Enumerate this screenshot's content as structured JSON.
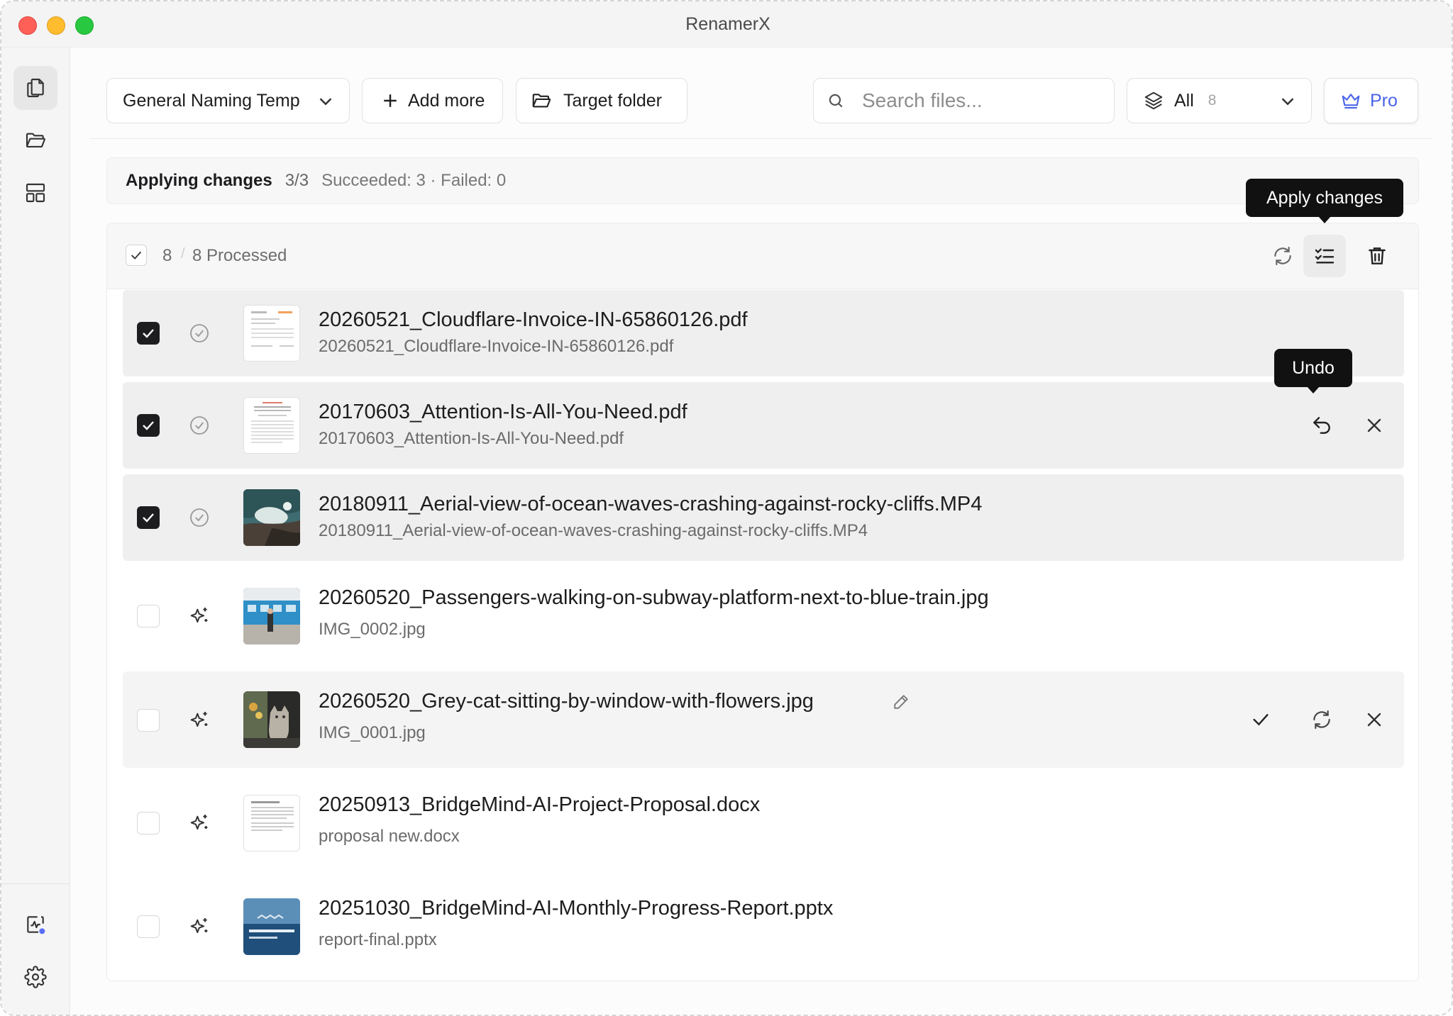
{
  "window": {
    "title": "RenamerX"
  },
  "sidebar": {
    "top": [
      "files-icon",
      "folder-open-icon",
      "layout-icon"
    ],
    "bottom": [
      "activity-icon",
      "gear-icon"
    ]
  },
  "toolbar": {
    "template_label": "General Naming Temp",
    "add_more_label": "Add more",
    "target_folder_label": "Target folder",
    "search_placeholder": "Search files...",
    "filter_label": "All",
    "filter_count": "8",
    "pro_label": "Pro"
  },
  "status": {
    "label": "Applying changes",
    "progress": "3/3",
    "result": "Succeeded: 3 · Failed: 0"
  },
  "list_header": {
    "selected_count": "8",
    "separator": "/",
    "processed_label": "8 Processed",
    "tooltip_apply": "Apply changes"
  },
  "files": [
    {
      "new_name": "20260521_Cloudflare-Invoice-IN-65860126.pdf",
      "original_name": "20260521_Cloudflare-Invoice-IN-65860126.pdf",
      "checked": true,
      "state": "done"
    },
    {
      "new_name": "20170603_Attention-Is-All-You-Need.pdf",
      "original_name": "20170603_Attention-Is-All-You-Need.pdf",
      "checked": true,
      "state": "done",
      "tooltip": "Undo"
    },
    {
      "new_name": "20180911_Aerial-view-of-ocean-waves-crashing-against-rocky-cliffs.MP4",
      "original_name": "20180911_Aerial-view-of-ocean-waves-crashing-against-rocky-cliffs.MP4",
      "checked": true,
      "state": "done"
    },
    {
      "new_name": "20260520_Passengers-walking-on-subway-platform-next-to-blue-train.jpg",
      "original_name": "IMG_0002.jpg",
      "checked": false,
      "state": "suggested"
    },
    {
      "new_name": "20260520_Grey-cat-sitting-by-window-with-flowers.jpg",
      "original_name": "IMG_0001.jpg",
      "checked": false,
      "state": "suggested"
    },
    {
      "new_name": "20250913_BridgeMind-AI-Project-Proposal.docx",
      "original_name": "proposal new.docx",
      "checked": false,
      "state": "suggested"
    },
    {
      "new_name": "20251030_BridgeMind-AI-Monthly-Progress-Report.pptx",
      "original_name": "report-final.pptx",
      "checked": false,
      "state": "suggested"
    }
  ],
  "colors": {
    "accent_pro": "#4a64e8",
    "checkbox_on": "#1d1d1f",
    "traffic_red": "#fe5f57",
    "traffic_yellow": "#febc2e",
    "traffic_green": "#28c840"
  }
}
